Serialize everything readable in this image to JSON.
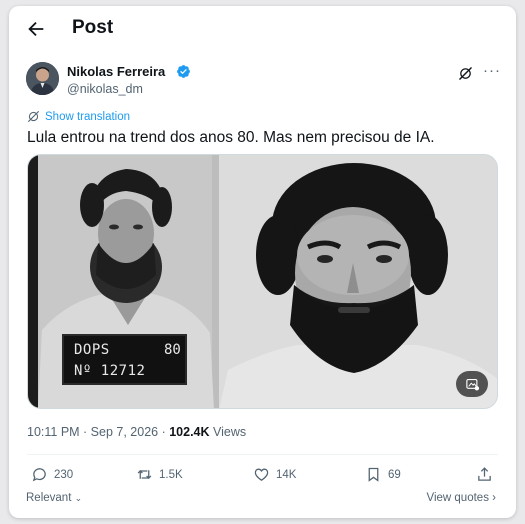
{
  "header": {
    "title": "Post",
    "back_icon": "arrow-left-icon"
  },
  "author": {
    "name": "Nikolas Ferreira",
    "handle": "@nikolas_dm",
    "verified": true,
    "verified_color": "#1d9bf0"
  },
  "post": {
    "show_translation": "Show translation",
    "text": "Lula entrou na trend dos anos 80. Mas nem precisou de IA.",
    "mugshot_board": {
      "line1_left": "DOPS",
      "line1_right": "80",
      "line2": "Nº 12712"
    }
  },
  "meta": {
    "time_date": "10:11 PM · Sep 7, 2026 · ",
    "views_count": "102.4K",
    "views_label": " Views"
  },
  "actions": {
    "replies": "230",
    "reposts": "1.5K",
    "likes": "14K",
    "bookmarks": "69"
  },
  "footer": {
    "sort_label": "Relevant",
    "view_quotes": "View quotes"
  },
  "colors": {
    "accent": "#1d9bf0",
    "text": "#0f1419",
    "secondary": "#536471"
  }
}
